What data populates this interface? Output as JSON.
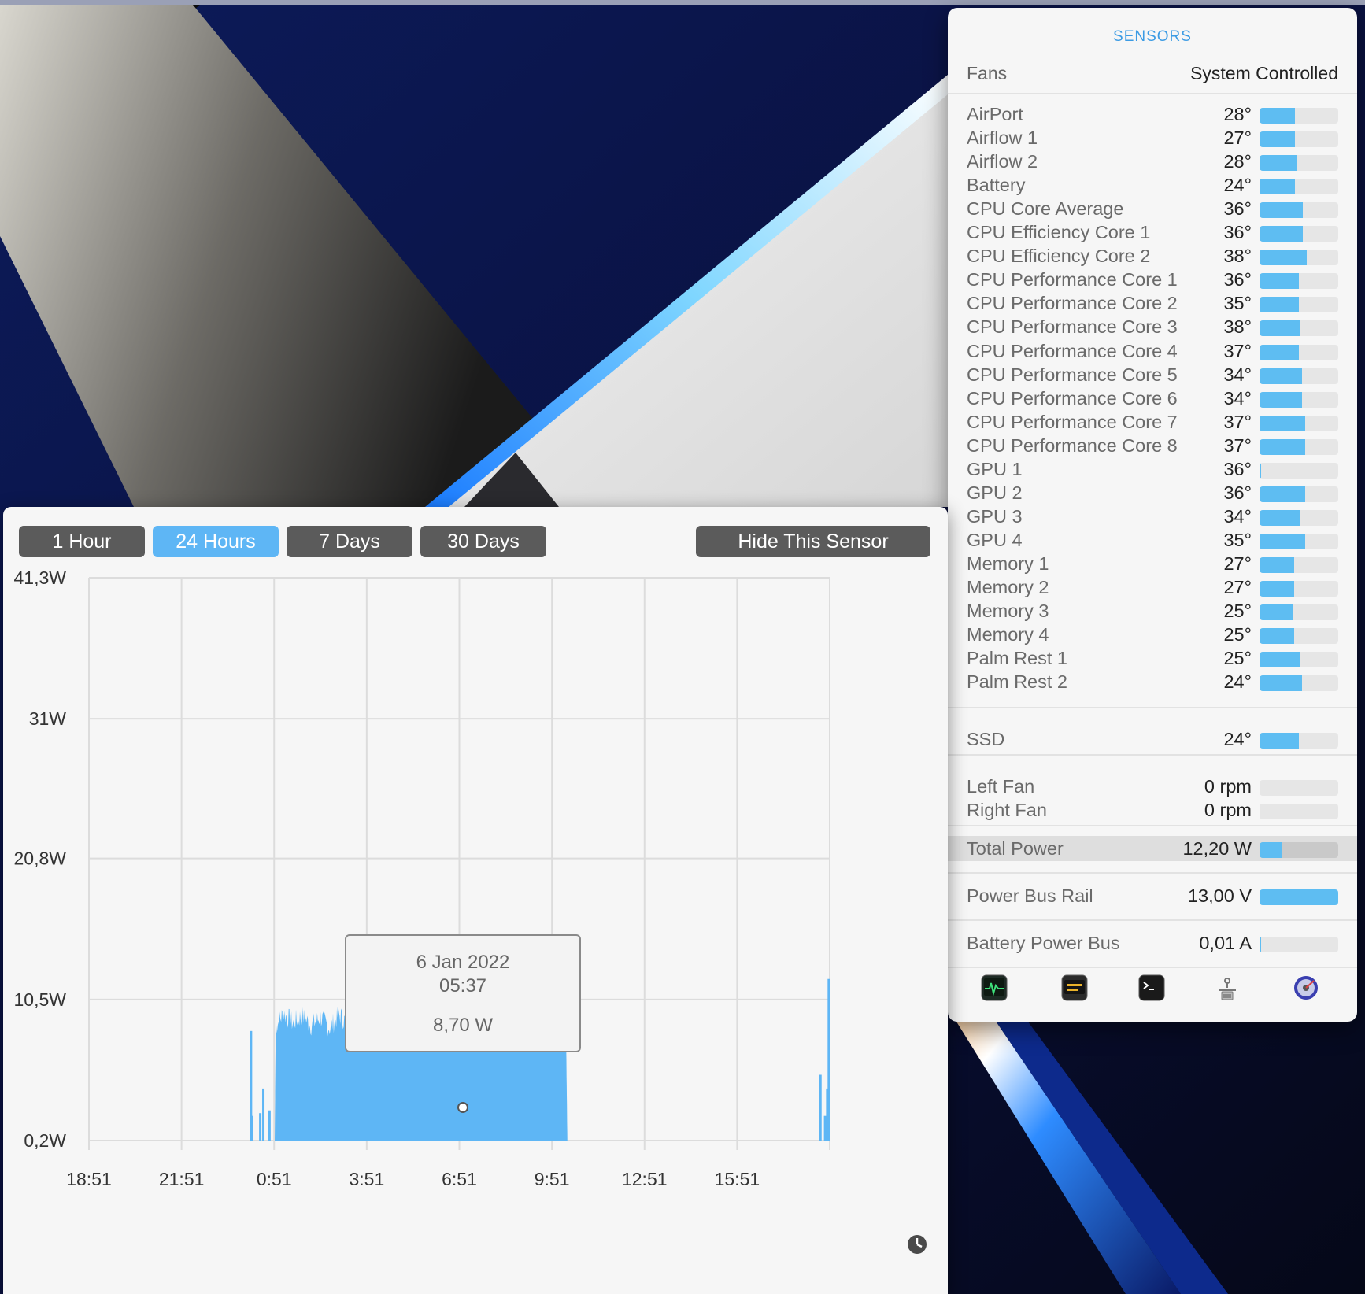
{
  "sensors": {
    "title": "SENSORS",
    "fans_label": "Fans",
    "fans_mode": "System Controlled",
    "temperatures": [
      {
        "label": "AirPort",
        "value": "28°",
        "level": 0.45
      },
      {
        "label": "Airflow 1",
        "value": "27°",
        "level": 0.45
      },
      {
        "label": "Airflow 2",
        "value": "28°",
        "level": 0.47
      },
      {
        "label": "Battery",
        "value": "24°",
        "level": 0.45
      },
      {
        "label": "CPU Core Average",
        "value": "36°",
        "level": 0.55
      },
      {
        "label": "CPU Efficiency Core 1",
        "value": "36°",
        "level": 0.55
      },
      {
        "label": "CPU Efficiency Core 2",
        "value": "38°",
        "level": 0.6
      },
      {
        "label": "CPU Performance Core 1",
        "value": "36°",
        "level": 0.5
      },
      {
        "label": "CPU Performance Core 2",
        "value": "35°",
        "level": 0.5
      },
      {
        "label": "CPU Performance Core 3",
        "value": "38°",
        "level": 0.52
      },
      {
        "label": "CPU Performance Core 4",
        "value": "37°",
        "level": 0.5
      },
      {
        "label": "CPU Performance Core 5",
        "value": "34°",
        "level": 0.54
      },
      {
        "label": "CPU Performance Core 6",
        "value": "34°",
        "level": 0.54
      },
      {
        "label": "CPU Performance Core 7",
        "value": "37°",
        "level": 0.58
      },
      {
        "label": "CPU Performance Core 8",
        "value": "37°",
        "level": 0.58
      },
      {
        "label": "GPU 1",
        "value": "36°",
        "level": 0.02
      },
      {
        "label": "GPU 2",
        "value": "36°",
        "level": 0.58
      },
      {
        "label": "GPU 3",
        "value": "34°",
        "level": 0.52
      },
      {
        "label": "GPU 4",
        "value": "35°",
        "level": 0.58
      },
      {
        "label": "Memory 1",
        "value": "27°",
        "level": 0.44
      },
      {
        "label": "Memory 2",
        "value": "27°",
        "level": 0.44
      },
      {
        "label": "Memory 3",
        "value": "25°",
        "level": 0.42
      },
      {
        "label": "Memory 4",
        "value": "25°",
        "level": 0.44
      },
      {
        "label": "Palm Rest 1",
        "value": "25°",
        "level": 0.52
      },
      {
        "label": "Palm Rest 2",
        "value": "24°",
        "level": 0.54
      }
    ],
    "ssd": {
      "label": "SSD",
      "value": "24°",
      "level": 0.5
    },
    "fans": [
      {
        "label": "Left Fan",
        "value": "0 rpm",
        "level": 0
      },
      {
        "label": "Right Fan",
        "value": "0 rpm",
        "level": 0
      }
    ],
    "total_power": {
      "label": "Total Power",
      "value": "12,20 W",
      "level": 0.28
    },
    "power_bus_rail": {
      "label": "Power Bus Rail",
      "value": "13,00 V",
      "level": 1.0
    },
    "battery_power_bus": {
      "label": "Battery Power Bus",
      "value": "0,01 A",
      "level": 0.02
    },
    "dock_icons": [
      "activity-monitor-icon",
      "console-icon",
      "terminal-icon",
      "system-information-icon",
      "disk-utility-icon"
    ],
    "accent_color": "#5ebdf2"
  },
  "history": {
    "buttons": [
      {
        "label": "1 Hour",
        "active": false
      },
      {
        "label": "24 Hours",
        "active": true
      },
      {
        "label": "7 Days",
        "active": false
      },
      {
        "label": "30 Days",
        "active": false
      }
    ],
    "hide_button": "Hide This Sensor",
    "tooltip": {
      "date": "6 Jan 2022",
      "time": "05:37",
      "value": "8,70 W"
    }
  },
  "chart_data": {
    "type": "area",
    "y_tick_labels": [
      "41,3W",
      "31W",
      "20,8W",
      "10,5W",
      "0,2W"
    ],
    "y_ticks": [
      41.3,
      31.0,
      20.8,
      10.5,
      0.2
    ],
    "ylim": [
      0.2,
      41.3
    ],
    "x_tick_labels": [
      "18:51",
      "21:51",
      "0:51",
      "3:51",
      "6:51",
      "9:51",
      "12:51",
      "15:51"
    ],
    "xlim_hours": [
      0,
      24
    ],
    "grid": true,
    "fill_color": "#5eb6f5",
    "series": [
      {
        "values": [
          {
            "x": 5.25,
            "y": 8.2
          },
          {
            "x": 5.28,
            "y": 2.0
          },
          {
            "x": 5.55,
            "y": 2.2
          },
          {
            "x": 5.65,
            "y": 4.0
          },
          {
            "x": 5.85,
            "y": 2.4
          },
          {
            "x": 6.02,
            "y": 0.2
          },
          {
            "x": 6.05,
            "y": 8.5
          },
          {
            "x": 6.3,
            "y": 9.5
          },
          {
            "x": 6.6,
            "y": 8.8
          },
          {
            "x": 6.9,
            "y": 9.3
          },
          {
            "x": 7.2,
            "y": 8.6
          },
          {
            "x": 7.5,
            "y": 9.2
          },
          {
            "x": 7.8,
            "y": 8.4
          },
          {
            "x": 8.1,
            "y": 9.4
          },
          {
            "x": 8.4,
            "y": 8.7
          },
          {
            "x": 8.7,
            "y": 9.0
          },
          {
            "x": 9.0,
            "y": 8.9
          },
          {
            "x": 9.3,
            "y": 8.6
          },
          {
            "x": 9.6,
            "y": 9.3
          },
          {
            "x": 9.9,
            "y": 8.6
          },
          {
            "x": 10.2,
            "y": 9.1
          },
          {
            "x": 10.5,
            "y": 8.8
          },
          {
            "x": 10.8,
            "y": 9.0
          },
          {
            "x": 11.1,
            "y": 8.7
          },
          {
            "x": 11.4,
            "y": 9.1
          },
          {
            "x": 11.7,
            "y": 8.5
          },
          {
            "x": 12.0,
            "y": 9.2
          },
          {
            "x": 12.3,
            "y": 8.6
          },
          {
            "x": 12.6,
            "y": 9.1
          },
          {
            "x": 12.9,
            "y": 8.8
          },
          {
            "x": 13.2,
            "y": 9.0
          },
          {
            "x": 13.5,
            "y": 8.7
          },
          {
            "x": 13.8,
            "y": 9.3
          },
          {
            "x": 14.1,
            "y": 8.8
          },
          {
            "x": 14.4,
            "y": 9.2
          },
          {
            "x": 14.7,
            "y": 8.9
          },
          {
            "x": 15.0,
            "y": 9.1
          },
          {
            "x": 15.3,
            "y": 8.9
          },
          {
            "x": 15.45,
            "y": 9.5
          },
          {
            "x": 15.5,
            "y": 0.2
          },
          {
            "x": 23.7,
            "y": 5.0
          },
          {
            "x": 23.85,
            "y": 2.0
          },
          {
            "x": 23.92,
            "y": 4.0
          },
          {
            "x": 23.97,
            "y": 12.0
          }
        ]
      }
    ]
  }
}
